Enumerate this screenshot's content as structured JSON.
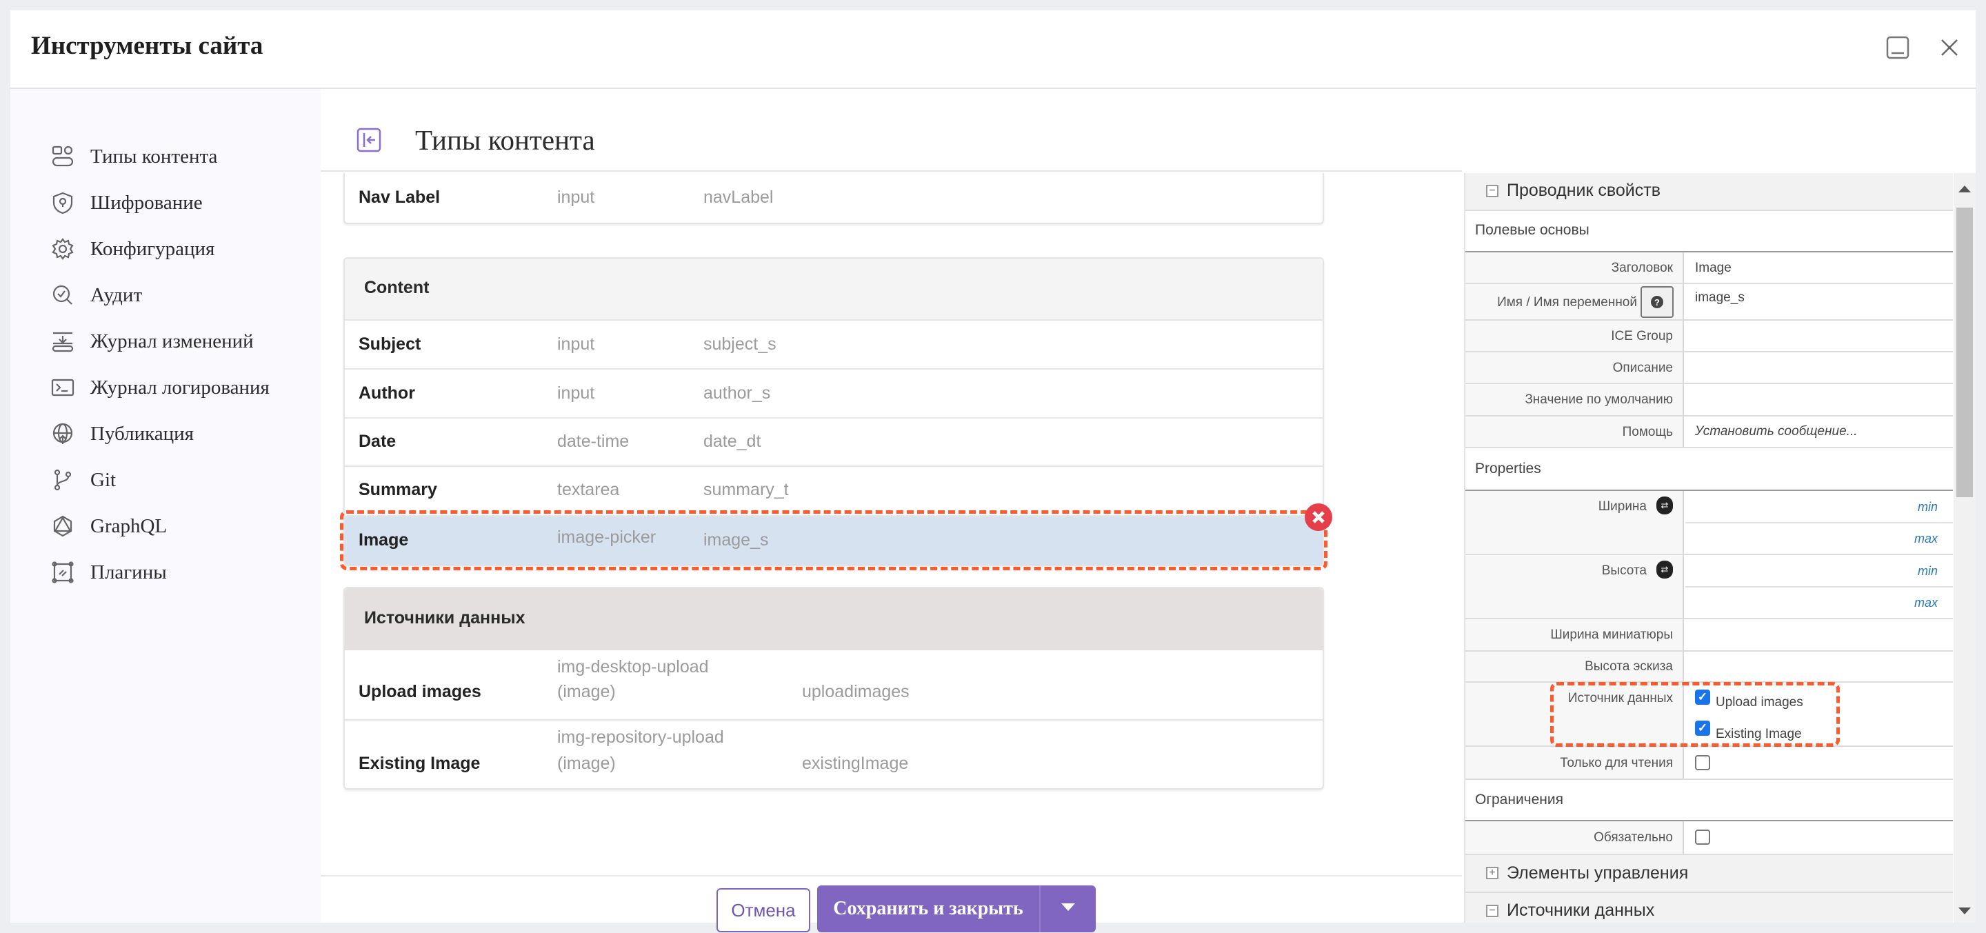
{
  "dialog": {
    "title": "Инструменты сайта",
    "minimize_icon": "minimize-icon",
    "close_icon": "close-icon"
  },
  "sidebar": {
    "items": [
      {
        "label": "Типы контента",
        "icon": "content-types-icon"
      },
      {
        "label": "Шифрование",
        "icon": "shield-icon"
      },
      {
        "label": "Конфигурация",
        "icon": "gear-icon"
      },
      {
        "label": "Аудит",
        "icon": "audit-search-icon"
      },
      {
        "label": "Журнал изменений",
        "icon": "changelog-icon"
      },
      {
        "label": "Журнал логирования",
        "icon": "terminal-icon"
      },
      {
        "label": "Публикация",
        "icon": "globe-publish-icon"
      },
      {
        "label": "Git",
        "icon": "git-branch-icon"
      },
      {
        "label": "GraphQL",
        "icon": "graphql-icon"
      },
      {
        "label": "Плагины",
        "icon": "plugin-icon"
      }
    ]
  },
  "main": {
    "title": "Типы контента",
    "nav_row": {
      "name": "Nav Label",
      "type": "input",
      "id": "navLabel"
    },
    "content_group": {
      "title": "Content",
      "rows": [
        {
          "name": "Subject",
          "type": "input",
          "id": "subject_s"
        },
        {
          "name": "Author",
          "type": "input",
          "id": "author_s"
        },
        {
          "name": "Date",
          "type": "date-time",
          "id": "date_dt"
        },
        {
          "name": "Summary",
          "type": "textarea",
          "id": "summary_t"
        },
        {
          "name": "Image",
          "type": "image-picker",
          "id": "image_s",
          "selected": true
        }
      ]
    },
    "datasources_group": {
      "title": "Источники данных",
      "rows": [
        {
          "name": "Upload images",
          "type_line1": "img-desktop-upload",
          "type_line2": "(image)",
          "id": "uploadimages"
        },
        {
          "name": "Existing Image",
          "type_line1": "img-repository-upload",
          "type_line2": "(image)",
          "id": "existingImage"
        }
      ]
    },
    "footer": {
      "cancel_label": "Отмена",
      "save_label": "Сохранить и закрыть"
    }
  },
  "properties_panel": {
    "header": "Проводник свойств",
    "sections": {
      "basics": "Полевые основы",
      "properties": "Properties",
      "constraints": "Ограничения"
    },
    "basics_rows": [
      {
        "label": "Заголовок",
        "value": "Image"
      },
      {
        "label": "Имя / Имя переменной",
        "value": "image_s"
      },
      {
        "label": "ICE Group",
        "value": ""
      },
      {
        "label": "Описание",
        "value": ""
      },
      {
        "label": "Значение по умолчанию",
        "value": ""
      },
      {
        "label": "Помощь",
        "value": "Установить сообщение..."
      }
    ],
    "width_label": "Ширина",
    "height_label": "Высота",
    "min_label": "min",
    "max_label": "max",
    "thumb_width_label": "Ширина миниатюры",
    "thumb_height_label": "Высота эскиза",
    "datasource_label": "Источник данных",
    "datasource_options": [
      {
        "label": "Upload images",
        "checked": true
      },
      {
        "label": "Existing Image",
        "checked": true
      }
    ],
    "readonly_label": "Только для чтения",
    "readonly_checked": false,
    "required_label": "Обязательно",
    "required_checked": false,
    "accordions": [
      {
        "label": "Элементы управления",
        "expanded": false
      },
      {
        "label": "Источники данных",
        "expanded": true
      }
    ]
  },
  "colors": {
    "accent": "#8066c0",
    "highlight_dash": "#ff5a2e",
    "selected_row": "#d6e2f0",
    "remove": "#e53f4a",
    "checkbox": "#1a73e8"
  }
}
